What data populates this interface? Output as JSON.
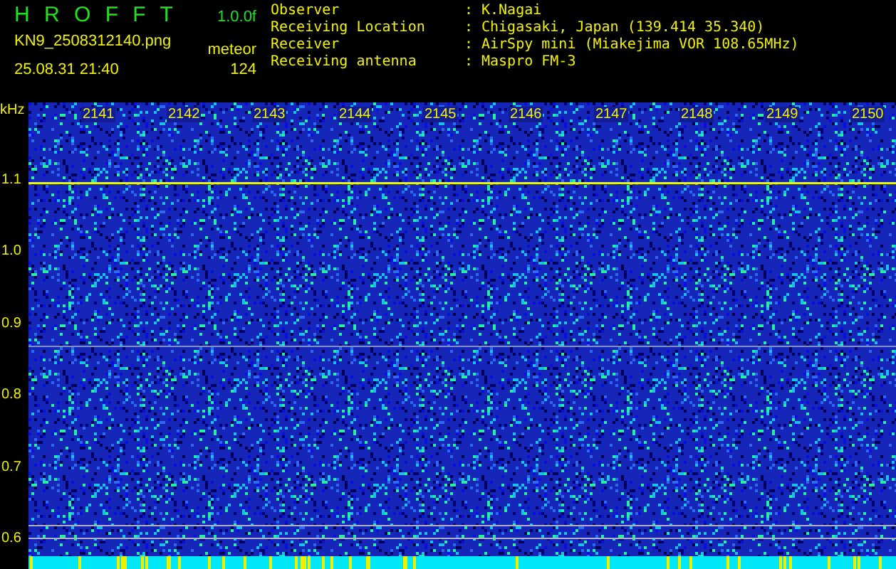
{
  "header": {
    "logo": "H R O F F T",
    "version": "1.0.0f",
    "filename": "KN9_2508312140.png",
    "datetime": "25.08.31 21:40",
    "mode": "meteor",
    "count": "124",
    "separator": ":",
    "info": [
      {
        "label": "Observer",
        "value": "K.Nagai"
      },
      {
        "label": "Receiving Location",
        "value": "Chigasaki, Japan (139.414 35.340)"
      },
      {
        "label": "Receiver",
        "value": "AirSpy mini (Miakejima VOR 108.65MHz)"
      },
      {
        "label": "Receiving antenna",
        "value": "Maspro FM-3"
      }
    ]
  },
  "spectrogram": {
    "y_unit": "kHz",
    "y_ticks": [
      "1.1",
      "1.0",
      "0.9",
      "0.8",
      "0.7",
      "0.6"
    ],
    "x_ticks": [
      "2141",
      "2142",
      "2143",
      "2144",
      "2145",
      "2146",
      "2147",
      "2148",
      "2149",
      "2150"
    ]
  }
}
